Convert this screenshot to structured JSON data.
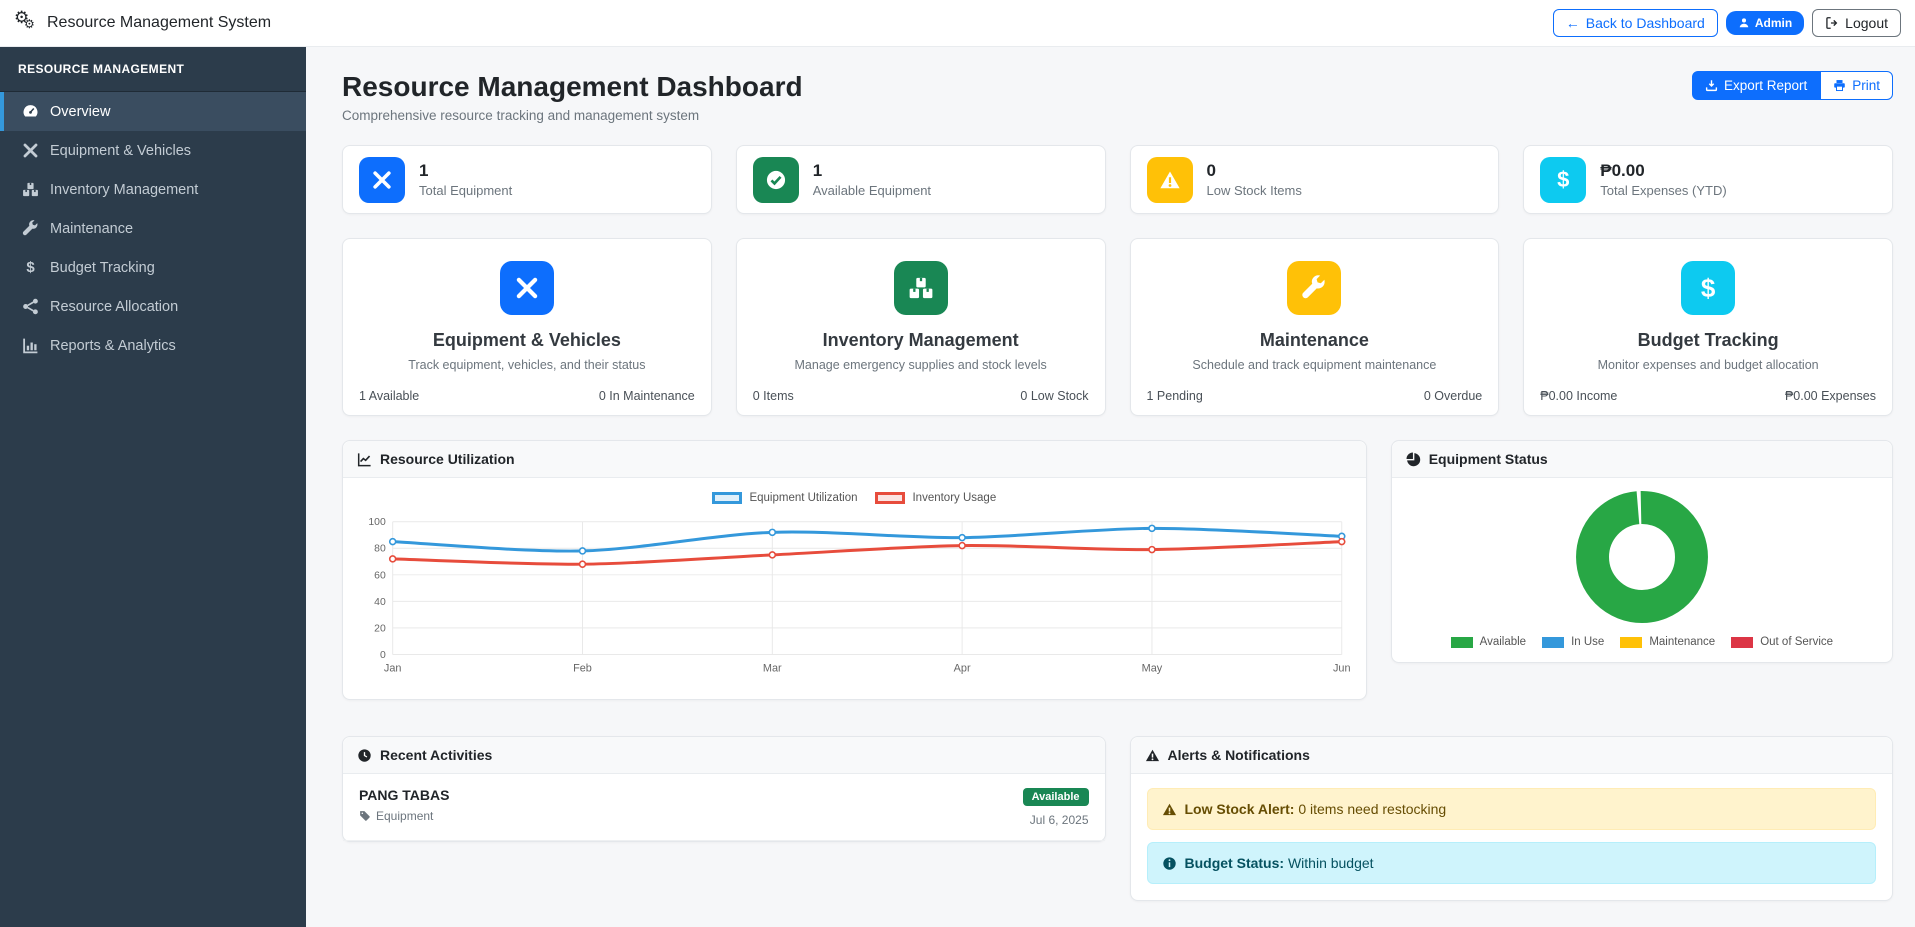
{
  "navbar": {
    "brand": "Resource Management System",
    "brand_icon": "gears-icon",
    "back_button": "Back to Dashboard",
    "admin_badge": "Admin",
    "logout_button": "Logout"
  },
  "sidebar": {
    "header": "RESOURCE MANAGEMENT",
    "items": [
      {
        "label": "Overview",
        "icon": "tachometer-icon",
        "active": true
      },
      {
        "label": "Equipment & Vehicles",
        "icon": "tools-icon",
        "active": false
      },
      {
        "label": "Inventory Management",
        "icon": "boxes-icon",
        "active": false
      },
      {
        "label": "Maintenance",
        "icon": "wrench-icon",
        "active": false
      },
      {
        "label": "Budget Tracking",
        "icon": "dollar-icon",
        "active": false
      },
      {
        "label": "Resource Allocation",
        "icon": "share-nodes-icon",
        "active": false
      },
      {
        "label": "Reports & Analytics",
        "icon": "chart-bar-icon",
        "active": false
      }
    ]
  },
  "page": {
    "title": "Resource Management Dashboard",
    "subtitle": "Comprehensive resource tracking and management system",
    "export_button": "Export Report",
    "print_button": "Print"
  },
  "colors": {
    "primary": "#0d6efd",
    "success": "#198754",
    "warning": "#ffc107",
    "info": "#0dcaf0",
    "danger": "#dc3545"
  },
  "stats": [
    {
      "value": "1",
      "label": "Total Equipment",
      "icon": "tools-icon",
      "color": "#0d6efd"
    },
    {
      "value": "1",
      "label": "Available Equipment",
      "icon": "check-circle-icon",
      "color": "#198754"
    },
    {
      "value": "0",
      "label": "Low Stock Items",
      "icon": "warning-triangle-icon",
      "color": "#ffc107"
    },
    {
      "value": "₱0.00",
      "label": "Total Expenses (YTD)",
      "icon": "dollar-icon",
      "color": "#0dcaf0"
    }
  ],
  "modules": [
    {
      "title": "Equipment & Vehicles",
      "description": "Track equipment, vehicles, and their status",
      "left": "1 Available",
      "right": "0 In Maintenance",
      "icon": "tools-icon",
      "color": "#0d6efd"
    },
    {
      "title": "Inventory Management",
      "description": "Manage emergency supplies and stock levels",
      "left": "0 Items",
      "right": "0 Low Stock",
      "icon": "boxes-icon",
      "color": "#198754"
    },
    {
      "title": "Maintenance",
      "description": "Schedule and track equipment maintenance",
      "left": "1 Pending",
      "right": "0 Overdue",
      "icon": "wrench-icon",
      "color": "#ffc107"
    },
    {
      "title": "Budget Tracking",
      "description": "Monitor expenses and budget allocation",
      "left": "₱0.00 Income",
      "right": "₱0.00 Expenses",
      "icon": "dollar-icon",
      "color": "#0dcaf0"
    }
  ],
  "chart_data": [
    {
      "type": "line",
      "title": "Resource Utilization",
      "x": [
        "Jan",
        "Feb",
        "Mar",
        "Apr",
        "May",
        "Jun"
      ],
      "series": [
        {
          "name": "Equipment Utilization",
          "color": "#3498db",
          "values": [
            85,
            78,
            92,
            88,
            95,
            89
          ]
        },
        {
          "name": "Inventory Usage",
          "color": "#e74c3c",
          "values": [
            72,
            68,
            75,
            82,
            79,
            85
          ]
        }
      ],
      "ylim": [
        0,
        100
      ],
      "yticks": [
        0,
        20,
        40,
        60,
        80,
        100
      ],
      "grid": true,
      "legend_position": "top"
    },
    {
      "type": "doughnut",
      "title": "Equipment Status",
      "labels": [
        "Available",
        "In Use",
        "Maintenance",
        "Out of Service"
      ],
      "values": [
        1,
        0,
        0,
        0
      ],
      "colors": [
        "#28a745",
        "#3498db",
        "#ffc107",
        "#dc3545"
      ],
      "legend_position": "bottom"
    }
  ],
  "recent_activities": {
    "title": "Recent Activities",
    "items": [
      {
        "name": "PANG TABAS",
        "category": "Equipment",
        "status": "Available",
        "status_color": "#198754",
        "date": "Jul 6, 2025"
      }
    ]
  },
  "alerts": {
    "title": "Alerts & Notifications",
    "items": [
      {
        "type": "warning",
        "bold": "Low Stock Alert:",
        "text": " 0 items need restocking"
      },
      {
        "type": "info",
        "bold": "Budget Status:",
        "text": " Within budget"
      }
    ]
  }
}
